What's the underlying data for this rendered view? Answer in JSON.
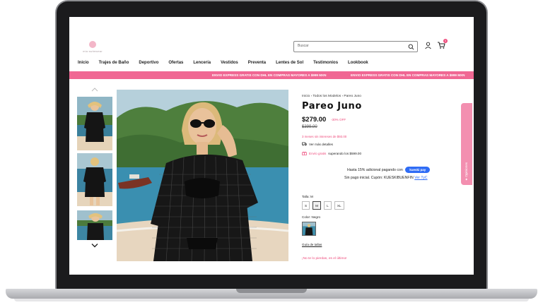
{
  "logo": {
    "text": "mia swimwear",
    "accent": "#f3b6c8"
  },
  "search": {
    "placeholder": "Buscar"
  },
  "cart": {
    "count": "0"
  },
  "nav": [
    "Inicio",
    "Trajes de Baño",
    "Deportivo",
    "Ofertas",
    "Lencería",
    "Vestidos",
    "Preventa",
    "Lentes de Sol",
    "Testimonios",
    "Lookbook"
  ],
  "promo": {
    "text": "ENVIO EXPRESS GRATIS CON DHL EN COMPRAS MAYORES A $999 MXN",
    "color": "#f06793"
  },
  "breadcrumb": [
    "Inicio",
    "Todos los Modelos",
    "Pareo Juno"
  ],
  "product": {
    "title": "Pareo Juno",
    "price": "$279.00",
    "discount": "-30% OFF",
    "old_price": "$399.00",
    "months_text": "3 meses sin intereses de $93.00",
    "details_text": "Ver más detalles",
    "shipping_prefix": "Envío gratis",
    "shipping_suffix": "superando los $599.00",
    "kueski_text": "Hasta 15% adicional pagando con",
    "kueski_badge": "kueski pay",
    "coupon_text": "Sin pago inicial. Cupón: KUESKIBUENFIN",
    "coupon_link": "Ver TyC",
    "size_label": "Talla: M",
    "sizes": [
      "S",
      "M",
      "L",
      "XL"
    ],
    "selected_size": "M",
    "color_label": "Color: Negro",
    "size_guide": "Guía de tallas",
    "urgency": "¡No te lo pierdas, es el último!"
  },
  "reviews_tab": "★ Opiniones",
  "colors": {
    "accent": "#ee4b7c",
    "kueski": "#2f6cf5"
  }
}
